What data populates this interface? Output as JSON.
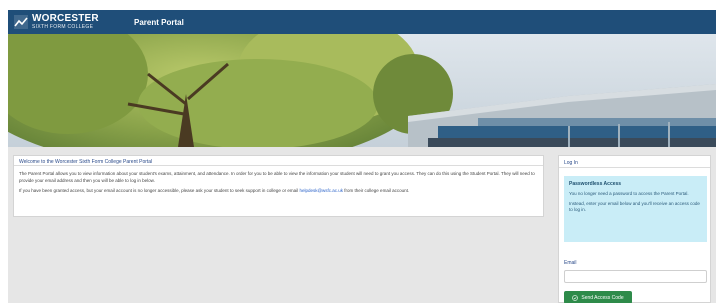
{
  "header": {
    "logo_main": "WORCESTER",
    "logo_sub": "SIXTH FORM COLLEGE",
    "portal_title": "Parent Portal",
    "logo_icon": "college-logo-mark"
  },
  "hero": {
    "image": "tree-and-college-building-photo"
  },
  "welcome": {
    "title": "Welcome to the Worcester Sixth Form College Parent Portal",
    "para1": "The Parent Portal allows you to view information about your student's exams, attainment, and attendance. In order for you to be able to view the information your student will need to grant you access. They can do this using the Student Portal. They will need to provide your email address and then you will be able to log in below.",
    "para2_before": "If you have been granted access, but your email account is no longer accessible, please ask your student to seek support in college or email",
    "para2_link": "helpdesk@wsfc.ac.uk",
    "para2_after": "from their college email account."
  },
  "login": {
    "title": "Log In",
    "passwordless_title": "Passwordless Access",
    "passwordless_p1": "You no longer need a password to access the Parent Portal.",
    "passwordless_p2": "Instead, enter your email below and you'll receive an access code to log in.",
    "email_label": "Email",
    "email_value": "",
    "send_label": "Send Access Code",
    "send_icon": "check-circle-icon"
  },
  "colors": {
    "header_bg": "#1f4e79",
    "page_bg": "#e6e6e6",
    "info_bg": "#c9edf7",
    "button_bg": "#2e8b4a",
    "link": "#2a62c9"
  }
}
